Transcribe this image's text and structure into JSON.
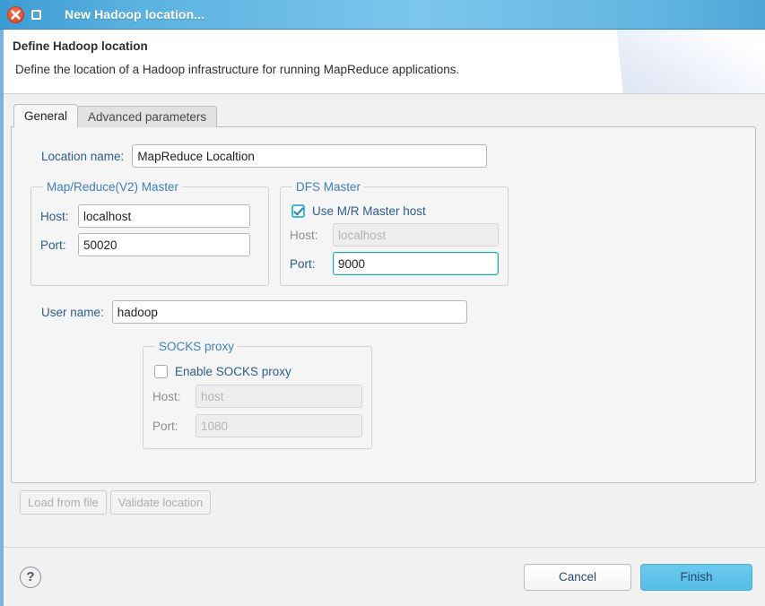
{
  "window": {
    "title": "New Hadoop location...",
    "close_icon": "close-icon",
    "maximize_icon": "maximize-icon"
  },
  "header": {
    "title": "Define Hadoop location",
    "description": "Define the location of a Hadoop infrastructure for running MapReduce applications."
  },
  "tabs": [
    {
      "label": "General",
      "active": true
    },
    {
      "label": "Advanced parameters",
      "active": false
    }
  ],
  "form": {
    "location_name": {
      "label": "Location name:",
      "value": "MapReduce Localtion",
      "placeholder": ""
    },
    "mr_master": {
      "legend": "Map/Reduce(V2) Master",
      "host_label": "Host:",
      "host_value": "localhost",
      "port_label": "Port:",
      "port_value": "50020"
    },
    "dfs_master": {
      "legend": "DFS Master",
      "use_mr_host_label": "Use M/R Master host",
      "use_mr_host_checked": true,
      "host_label": "Host:",
      "host_value": "localhost",
      "host_disabled": true,
      "port_label": "Port:",
      "port_value": "9000",
      "port_focused": true
    },
    "user_name": {
      "label": "User name:",
      "value": "hadoop"
    },
    "socks_proxy": {
      "legend": "SOCKS proxy",
      "enable_label": "Enable SOCKS proxy",
      "enable_checked": false,
      "host_label": "Host:",
      "host_value": "host",
      "host_disabled": true,
      "port_label": "Port:",
      "port_value": "1080",
      "port_disabled": true
    }
  },
  "actions": {
    "load_from_file": "Load from file",
    "validate_location": "Validate location",
    "help_icon": "?",
    "cancel": "Cancel",
    "finish": "Finish"
  },
  "colors": {
    "titlebar_blue": "#5bb2e0",
    "close_orange": "#e2512a",
    "label_blue": "#2c5d8f",
    "legend_blue": "#3f7fbf",
    "focus_teal": "#21a8b8",
    "finish_blue": "#55bde6"
  }
}
